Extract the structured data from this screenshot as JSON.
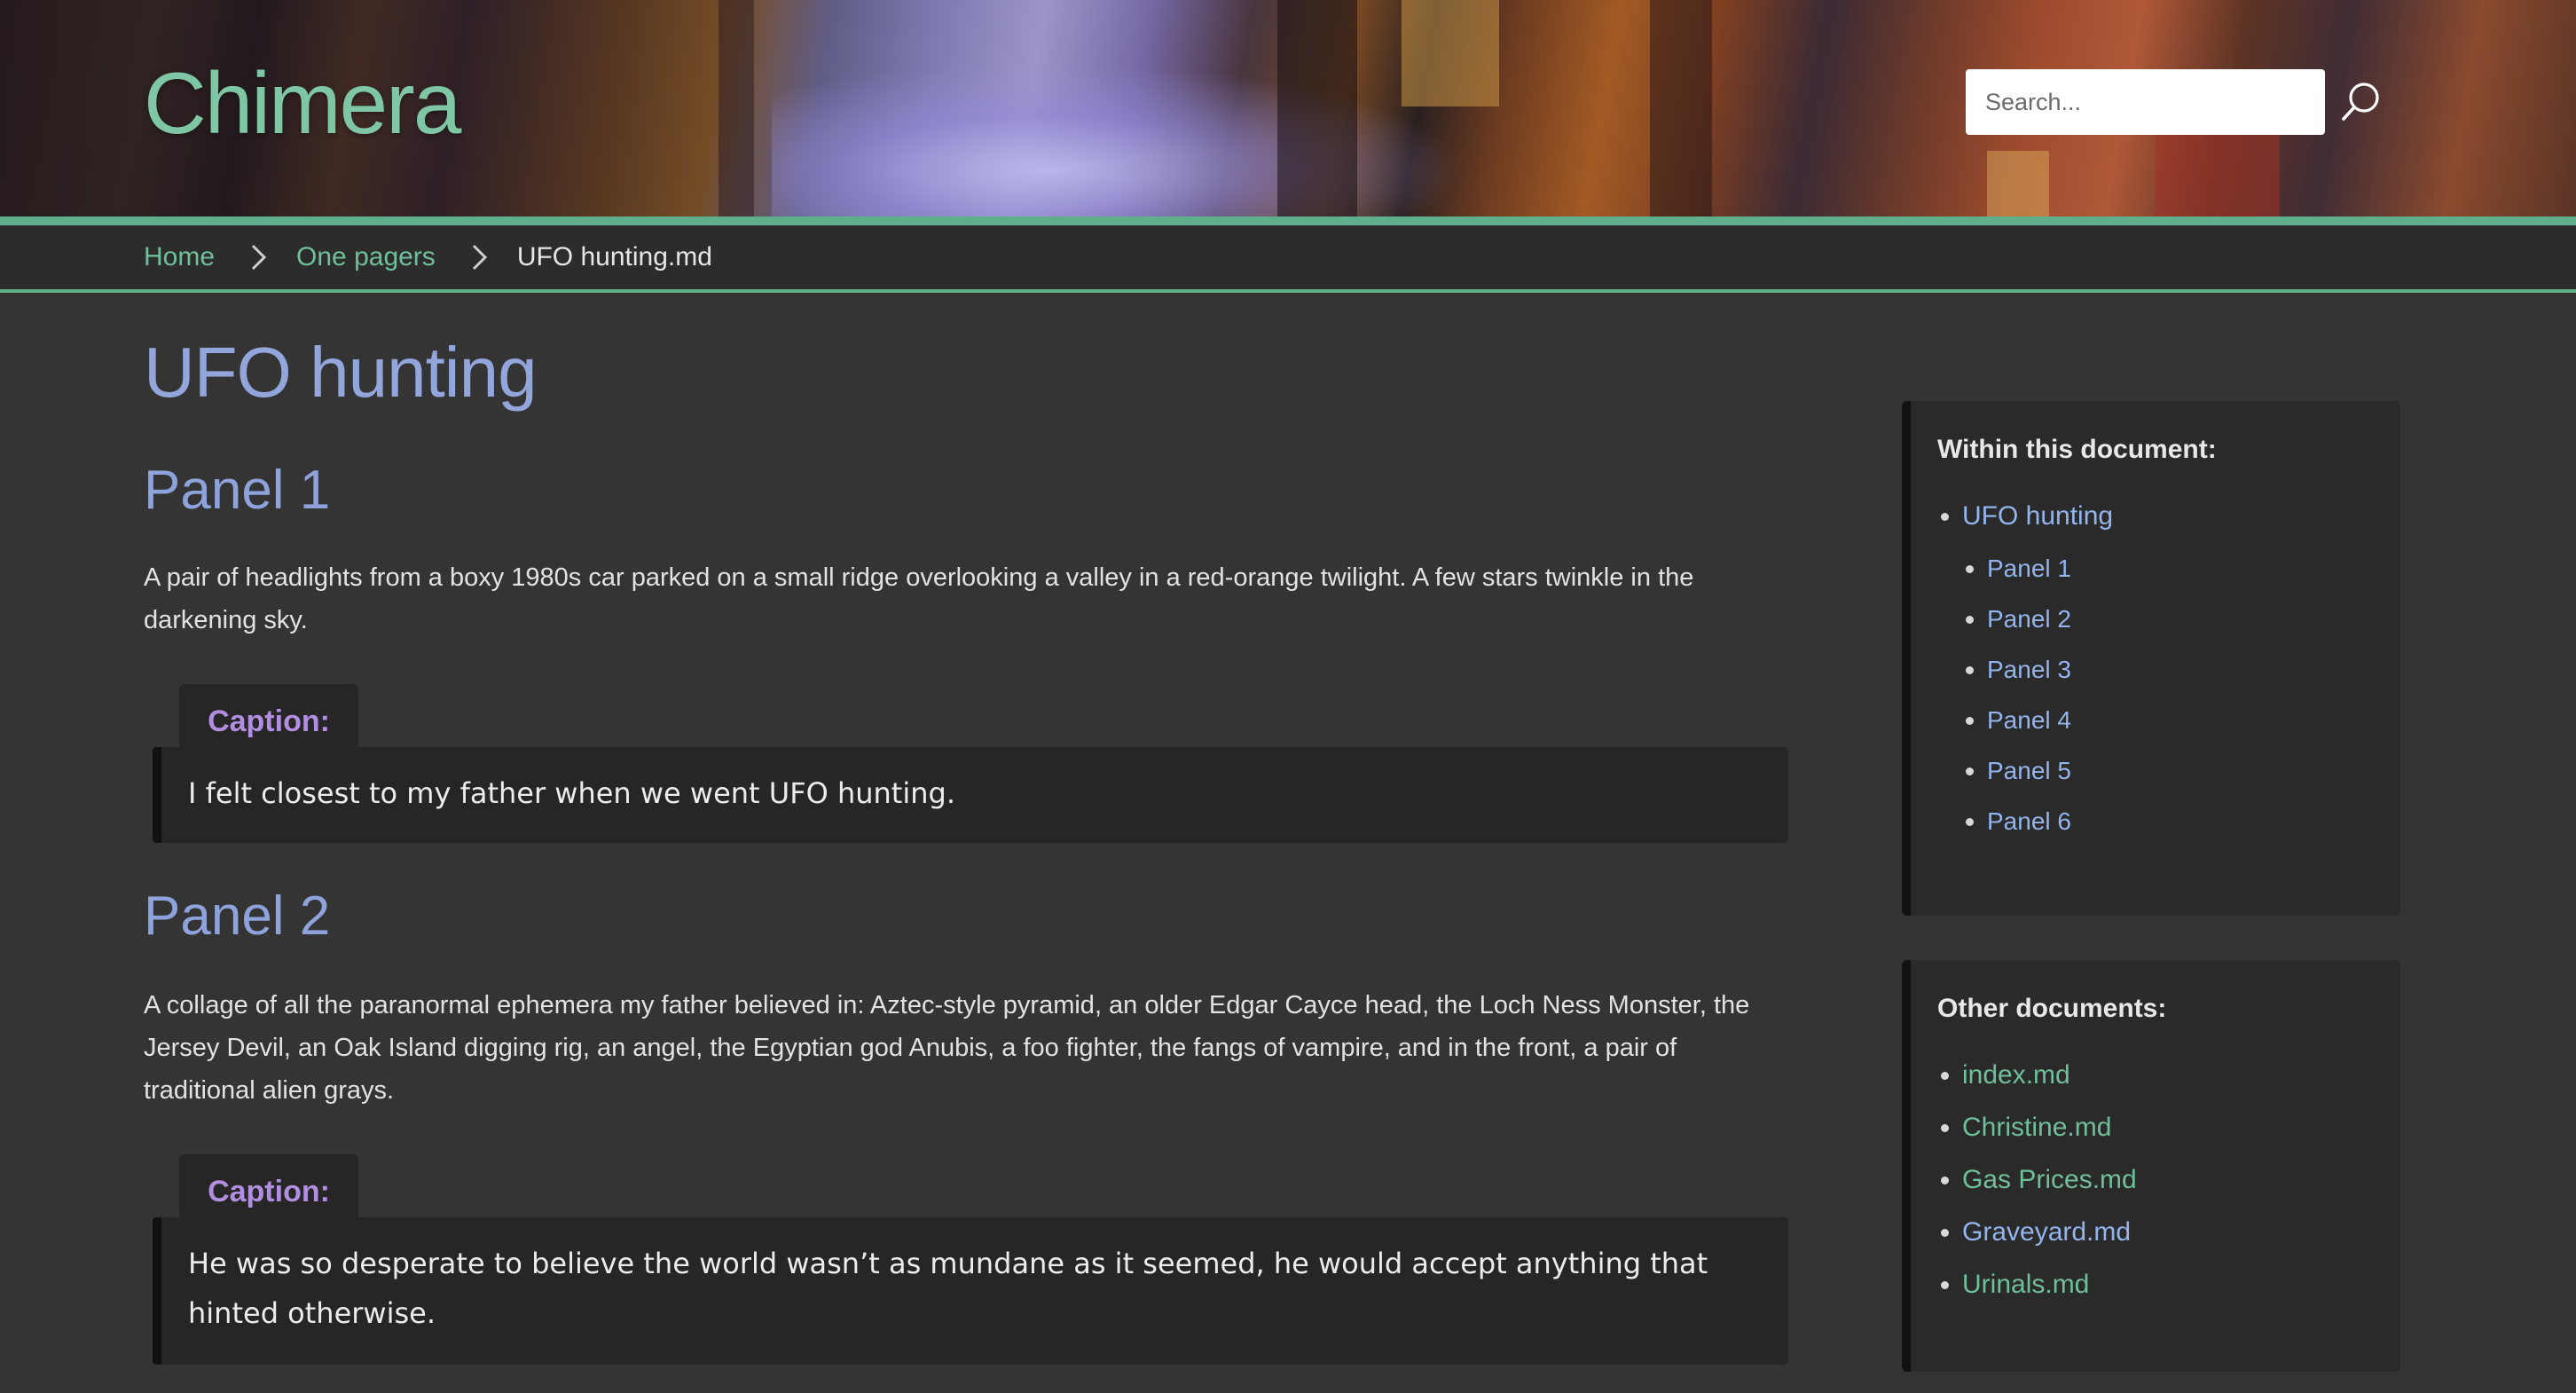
{
  "site": {
    "title": "Chimera"
  },
  "search": {
    "placeholder": "Search..."
  },
  "breadcrumb": {
    "items": [
      "Home",
      "One pagers"
    ],
    "current": "UFO hunting.md"
  },
  "page": {
    "title": "UFO hunting",
    "panels": [
      {
        "heading": "Panel 1",
        "text": "A pair of headlights from a boxy 1980s car parked on a small ridge overlooking a valley in a red-orange twilight. A few stars twinkle in the darkening sky.",
        "caption_label": "Caption:",
        "caption": "I felt closest to my father when we went UFO hunting."
      },
      {
        "heading": "Panel 2",
        "text": "A collage of all the paranormal ephemera my father believed in: Aztec-style pyramid, an older Edgar Cayce head, the Loch Ness Monster, the Jersey Devil, an Oak Island digging rig, an angel, the Egyptian god Anubis, a foo fighter, the fangs of vampire, and in the front, a pair of traditional alien grays.",
        "caption_label": "Caption:",
        "caption": "He was so desperate to believe the world wasn’t as mundane as it seemed, he would accept anything that hinted otherwise."
      }
    ]
  },
  "toc": {
    "heading": "Within this document:",
    "top": "UFO hunting",
    "items": [
      "Panel 1",
      "Panel 2",
      "Panel 3",
      "Panel 4",
      "Panel 5",
      "Panel 6"
    ]
  },
  "docs": {
    "heading": "Other documents:",
    "items": [
      {
        "label": "index.md",
        "color": "#6fc09a"
      },
      {
        "label": "Christine.md",
        "color": "#6fc09a"
      },
      {
        "label": "Gas Prices.md",
        "color": "#6fc09a"
      },
      {
        "label": "Graveyard.md",
        "color": "#93b4ec"
      },
      {
        "label": "Urinals.md",
        "color": "#6fc09a"
      }
    ]
  },
  "colors": {
    "accent_green": "#5fae8c",
    "heading_blue": "#93a6dc",
    "caption_purple": "#b28ee0",
    "link_blue": "#93b4ec"
  }
}
